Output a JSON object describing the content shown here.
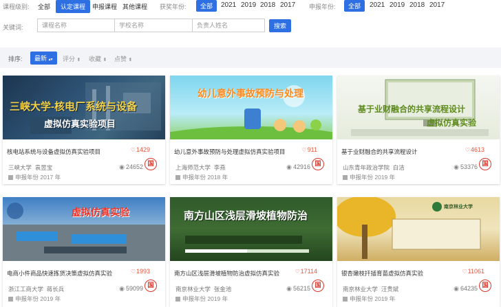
{
  "filters": {
    "course_level_label": "课程级别:",
    "course_levels": [
      "全部",
      "认定课程",
      "申报课程",
      "其他课程"
    ],
    "award_year_label": "获奖年份:",
    "award_years": [
      "全部",
      "2021",
      "2019",
      "2018",
      "2017"
    ],
    "apply_year_label": "申报年份:",
    "apply_years": [
      "全部",
      "2021",
      "2019",
      "2018",
      "2017"
    ]
  },
  "search": {
    "keyword_label": "关键词:",
    "course_placeholder": "课程名称",
    "school_placeholder": "学校名称",
    "person_placeholder": "负责人姓名",
    "button_label": "搜索"
  },
  "sort": {
    "label": "排序:",
    "options": [
      "最新",
      "评分",
      "收藏",
      "点赞"
    ],
    "selected_arrow": "▴▾",
    "option_arrow": "⬍"
  },
  "cards": [
    {
      "title": "核电站系统与设备虚拟仿真实验项目",
      "likes": "1429",
      "school": "三峡大学",
      "person": "袁昱宝",
      "views": "24652",
      "year": "申报年份 2017 年",
      "badge": "国",
      "thumb_lines": [
        "三峡大学-核电厂系统与设备",
        "虚拟仿真实验项目"
      ]
    },
    {
      "title": "幼儿意外事故预防与处理虚拟仿真实验项目",
      "likes": "911",
      "school": "上海师范大学",
      "person": "李燕",
      "views": "42916",
      "year": "申报年份 2018 年",
      "badge": "国",
      "thumb_lines": [
        "幼儿意外事故预防与处理"
      ]
    },
    {
      "title": "基于业财融合的共享流程设计",
      "likes": "4613",
      "school": "山东青年政治学院",
      "person": "白洁",
      "views": "53376",
      "year": "申报年份 2019 年",
      "badge": "国",
      "thumb_lines": [
        "基于业财融合的共享流程设计",
        "虚拟仿真实验"
      ]
    },
    {
      "title": "电商小件商品快速拣货决策虚拟仿真实验",
      "likes": "1993",
      "school": "浙江工商大学",
      "person": "蒋长兵",
      "views": "59099",
      "year": "申报年份 2019 年",
      "badge": "国",
      "thumb_lines": [
        "虚拟仿真实验"
      ]
    },
    {
      "title": "南方山区浅层滑坡植物防治虚拟仿真实验",
      "likes": "17114",
      "school": "南京林业大学",
      "person": "张金池",
      "views": "56215",
      "year": "申报年份 2019 年",
      "badge": "国",
      "thumb_lines": [
        "南方山区浅层滑坡植物防治"
      ]
    },
    {
      "title": "银杏嫩枝扦插育苗虚拟仿真实验",
      "likes": "11061",
      "school": "南京林业大学",
      "person": "汪贵斌",
      "views": "64235",
      "year": "申报年份 2019 年",
      "badge": "国",
      "thumb_lines": [
        "南京林业大学"
      ]
    }
  ]
}
